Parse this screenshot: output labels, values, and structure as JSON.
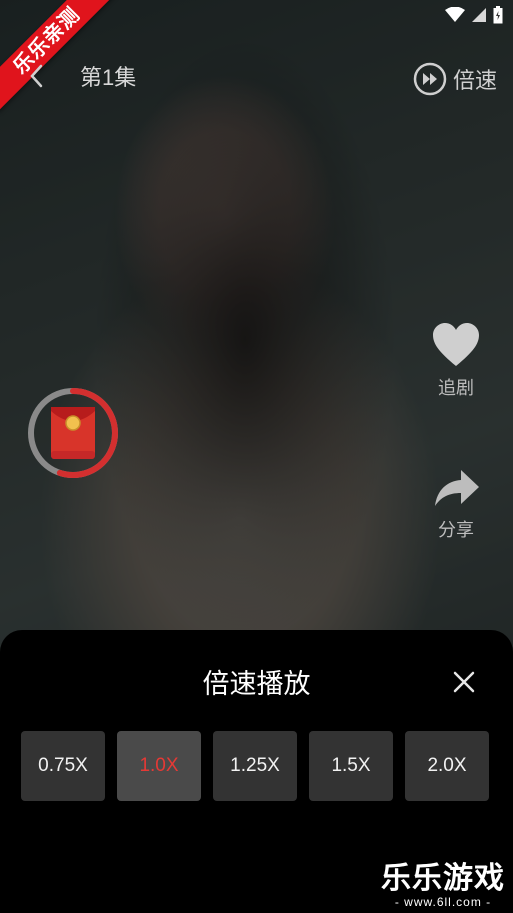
{
  "ribbon": {
    "text": "乐乐亲测"
  },
  "header": {
    "episode": "第1集",
    "speed_label": "倍速"
  },
  "side": {
    "follow_label": "追剧",
    "share_label": "分享"
  },
  "red_packet": {
    "progress": 0.55
  },
  "sheet": {
    "title": "倍速播放",
    "options": [
      "0.75X",
      "1.0X",
      "1.25X",
      "1.5X",
      "2.0X"
    ],
    "selected": "1.0X"
  },
  "watermark": {
    "main": "乐乐游戏",
    "sub": "- www.6ll.com -"
  },
  "colors": {
    "accent": "#e53935",
    "sheet_bg": "#000000",
    "option_bg": "#333333"
  }
}
